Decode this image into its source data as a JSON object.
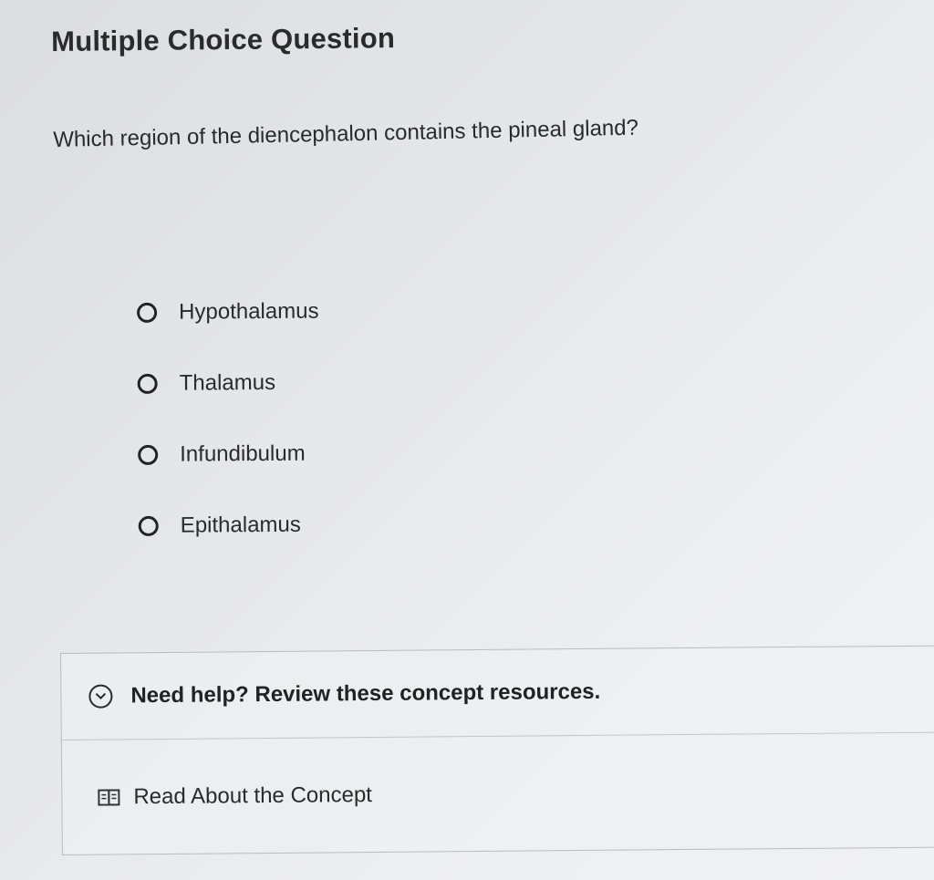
{
  "heading": "Multiple Choice Question",
  "question": "Which region of the diencephalon contains the pineal gland?",
  "options": [
    {
      "label": "Hypothalamus"
    },
    {
      "label": "Thalamus"
    },
    {
      "label": "Infundibulum"
    },
    {
      "label": "Epithalamus"
    }
  ],
  "help": {
    "title": "Need help? Review these concept resources.",
    "icon": "chevron-down-circle-icon",
    "resources": [
      {
        "label": "Read About the Concept",
        "icon": "book-icon"
      }
    ]
  }
}
